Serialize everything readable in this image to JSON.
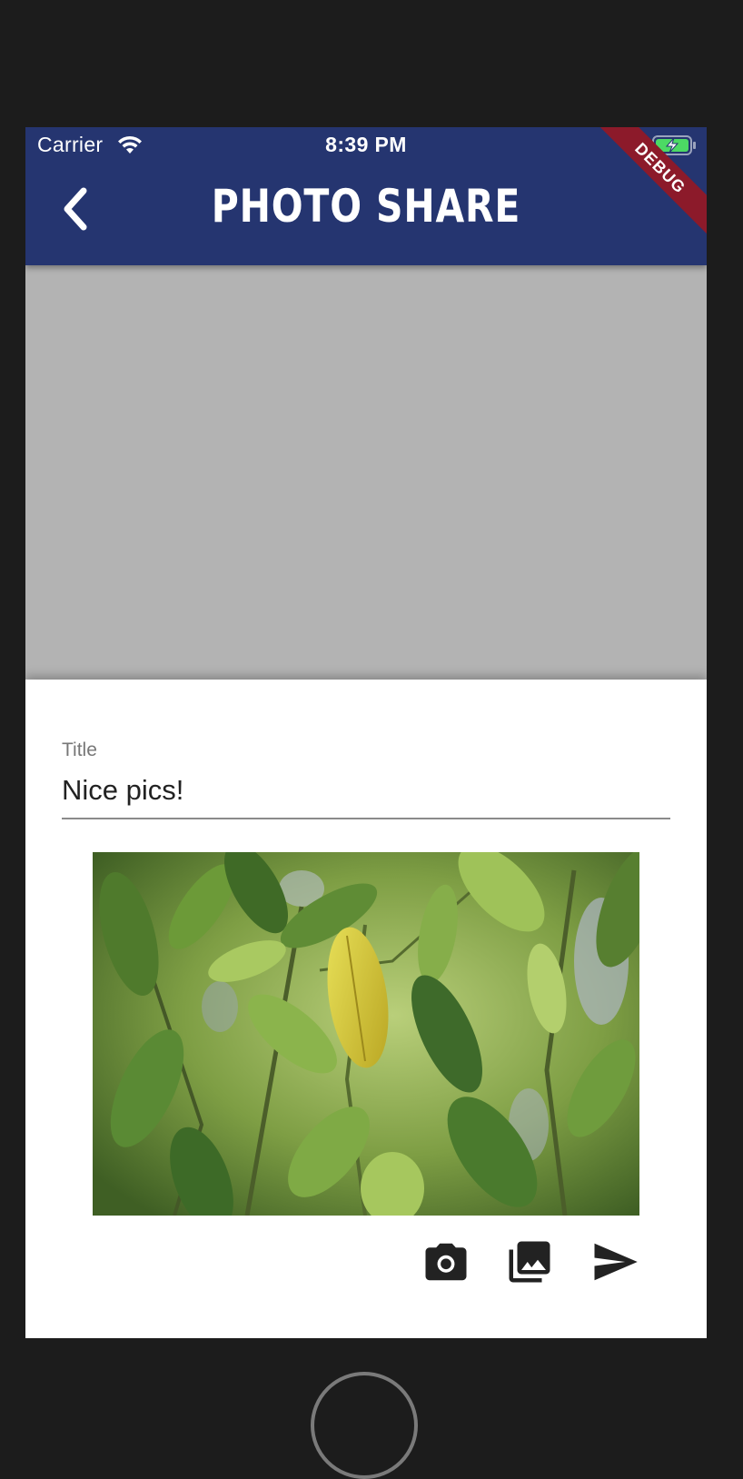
{
  "status_bar": {
    "carrier": "Carrier",
    "time": "8:39 PM",
    "wifi_icon": "wifi-icon",
    "battery_icon": "battery-charging-icon",
    "battery_color": "#4cd964"
  },
  "appbar": {
    "title": "PHOTO SHARE",
    "back_icon": "chevron-left-icon",
    "background_color": "#253570"
  },
  "debug_banner": {
    "label": "DEBUG",
    "color": "#8c1a2a"
  },
  "form": {
    "title_label": "Title",
    "title_value": "Nice pics!"
  },
  "photo": {
    "description_icon": "photo-leaves"
  },
  "actions": {
    "camera_icon": "camera-icon",
    "gallery_icon": "photo-library-icon",
    "send_icon": "send-icon"
  }
}
